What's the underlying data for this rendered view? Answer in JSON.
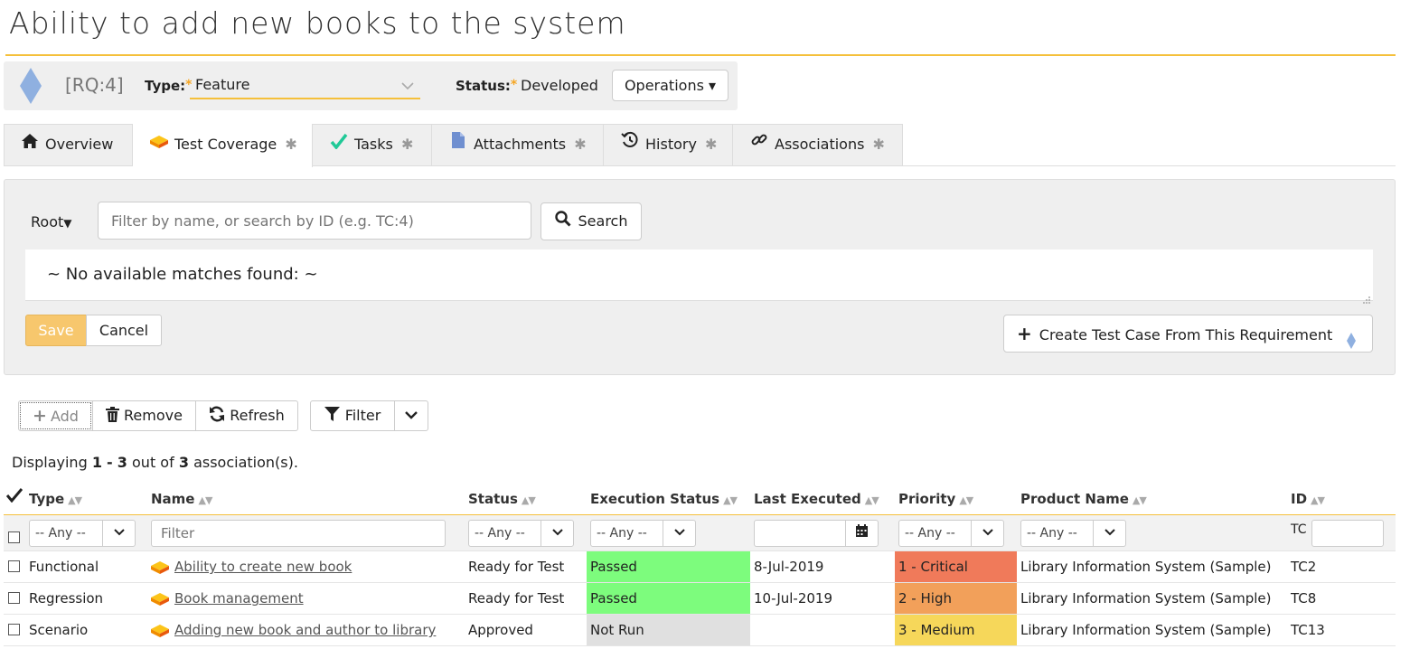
{
  "page": {
    "title": "Ability to add new books to the system"
  },
  "requirement": {
    "id": "[RQ:4]",
    "type_label": "Type:",
    "type_value": "Feature",
    "status_label": "Status:",
    "status_value": "Developed",
    "required_marker": "*",
    "operations_label": "Operations"
  },
  "tabs": [
    {
      "label": "Overview",
      "icon": "home-icon",
      "active": false
    },
    {
      "label": "Test Coverage",
      "icon": "test-case-icon",
      "active": true
    },
    {
      "label": "Tasks",
      "icon": "checkmark-icon",
      "active": false
    },
    {
      "label": "Attachments",
      "icon": "document-icon",
      "active": false
    },
    {
      "label": "History",
      "icon": "history-icon",
      "active": false
    },
    {
      "label": "Associations",
      "icon": "link-icon",
      "active": false
    }
  ],
  "coverage_panel": {
    "root_label": "Root",
    "filter_placeholder": "Filter by name, or search by ID (e.g. TC:4)",
    "search_label": "Search",
    "no_matches": "~ No available matches found: ~",
    "save_label": "Save",
    "cancel_label": "Cancel",
    "create_label": "Create Test Case From This Requirement"
  },
  "toolbar": {
    "add_label": "Add",
    "remove_label": "Remove",
    "refresh_label": "Refresh",
    "filter_label": "Filter"
  },
  "summary": {
    "prefix": "Displaying",
    "from": "1",
    "dash": "-",
    "to": "3",
    "out_of": "out of",
    "total": "3",
    "suffix": "association(s)."
  },
  "table": {
    "columns": [
      "Type",
      "Name",
      "Status",
      "Execution Status",
      "Last Executed",
      "Priority",
      "Product Name",
      "ID"
    ],
    "filters": {
      "any": "-- Any --",
      "name_placeholder": "Filter",
      "id_prefix": "TC"
    },
    "rows": [
      {
        "type": "Functional",
        "name": "Ability to create new book",
        "status": "Ready for Test",
        "execution_status": "Passed",
        "last_executed": "8-Jul-2019",
        "priority": "1 - Critical",
        "product": "Library Information System (Sample)",
        "id": "TC2"
      },
      {
        "type": "Regression",
        "name": "Book management",
        "status": "Ready for Test",
        "execution_status": "Passed",
        "last_executed": "10-Jul-2019",
        "priority": "2 - High",
        "product": "Library Information System (Sample)",
        "id": "TC8"
      },
      {
        "type": "Scenario",
        "name": "Adding new book and author to library",
        "status": "Approved",
        "execution_status": "Not Run",
        "last_executed": "",
        "priority": "3 - Medium",
        "product": "Library Information System (Sample)",
        "id": "TC13"
      }
    ]
  },
  "colors": {
    "accent": "#f5c03b",
    "passed": "#7dfc7d",
    "not_run": "#e0e0e0",
    "critical": "#f07a5a",
    "high": "#f2a05a",
    "medium": "#f6d75a"
  }
}
